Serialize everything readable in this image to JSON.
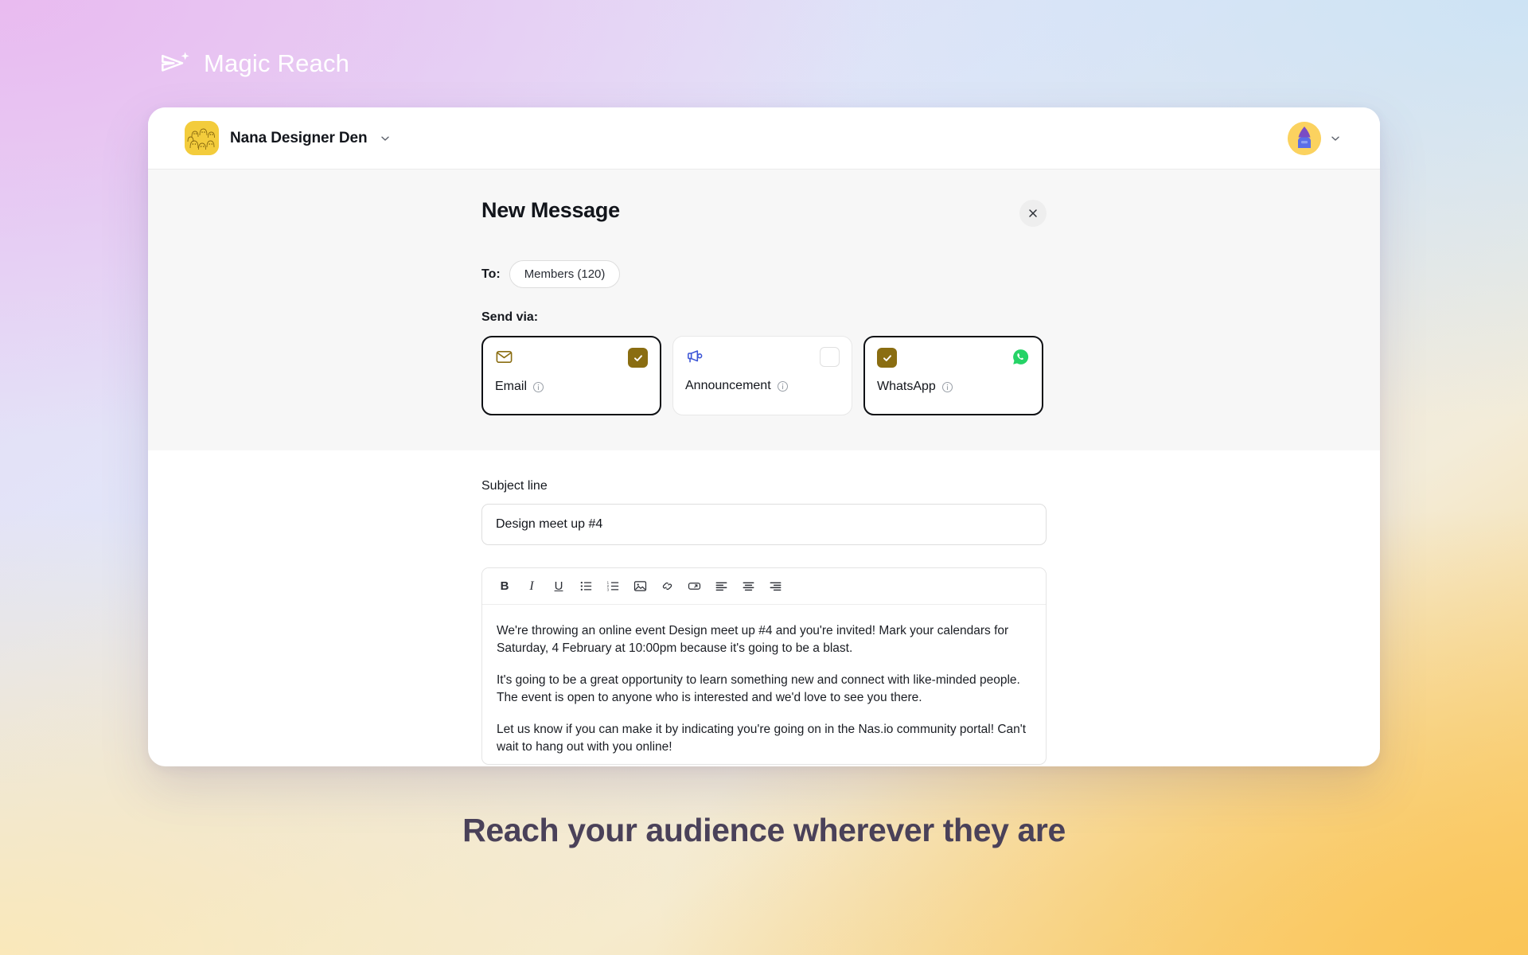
{
  "brand": {
    "name": "Magic Reach",
    "logo_icon": "paper-plane-sparkle-icon",
    "logo_color": "#ffffff"
  },
  "app_header": {
    "community_name": "Nana Designer Den",
    "community_avatar_icon": "community-avatar-yellow-faces",
    "community_dropdown_icon": "chevron-down-icon",
    "profile_avatar_icon": "user-avatar-wizard",
    "profile_dropdown_icon": "chevron-down-icon"
  },
  "modal": {
    "title": "New Message",
    "close_icon": "close-icon",
    "to_label": "To:",
    "to_recipients": "Members (120)",
    "send_via_label": "Send via:",
    "channels": [
      {
        "label": "Email",
        "icon": "envelope-icon",
        "icon_color": "#8a6d11",
        "checked": true,
        "checkbox_position": "right",
        "info_icon": "info-icon"
      },
      {
        "label": "Announcement",
        "icon": "megaphone-icon",
        "icon_color": "#3a53d6",
        "checked": false,
        "checkbox_position": "right",
        "info_icon": "info-icon"
      },
      {
        "label": "WhatsApp",
        "icon": "whatsapp-icon",
        "icon_color": "#25d366",
        "checked": true,
        "checkbox_position": "left",
        "info_icon": "info-icon"
      }
    ],
    "subject": {
      "label": "Subject line",
      "value": "Design meet up #4",
      "placeholder": "Subject line"
    },
    "editor": {
      "toolbar": [
        {
          "name": "bold-icon",
          "label": "B"
        },
        {
          "name": "italic-icon",
          "label": "I"
        },
        {
          "name": "underline-icon",
          "label": "U"
        },
        {
          "name": "bulleted-list-icon",
          "label": ""
        },
        {
          "name": "numbered-list-icon",
          "label": ""
        },
        {
          "name": "image-icon",
          "label": ""
        },
        {
          "name": "link-icon",
          "label": ""
        },
        {
          "name": "button-link-icon",
          "label": ""
        },
        {
          "name": "align-left-icon",
          "label": ""
        },
        {
          "name": "align-center-icon",
          "label": ""
        },
        {
          "name": "align-right-icon",
          "label": ""
        }
      ],
      "paragraphs": [
        "We're throwing an online event Design meet up #4 and you're invited! Mark your calendars for Saturday, 4 February at 10:00pm because it's going to be a blast.",
        "It's going to be a great opportunity to learn something new and connect with like-minded people.\nThe event is open to anyone who is interested and we'd love to see you there.",
        "Let us know if you can make it by indicating you're going on in the Nas.io community portal! Can't wait to hang out with you online!"
      ]
    }
  },
  "tagline": "Reach your audience wherever they are",
  "colors": {
    "accent_gold": "#8a6d11",
    "whatsapp_green": "#25d366",
    "announcement_blue": "#3a53d6",
    "tagline_color": "#4a4159",
    "avatar_yellow": "#f5cf3f"
  }
}
